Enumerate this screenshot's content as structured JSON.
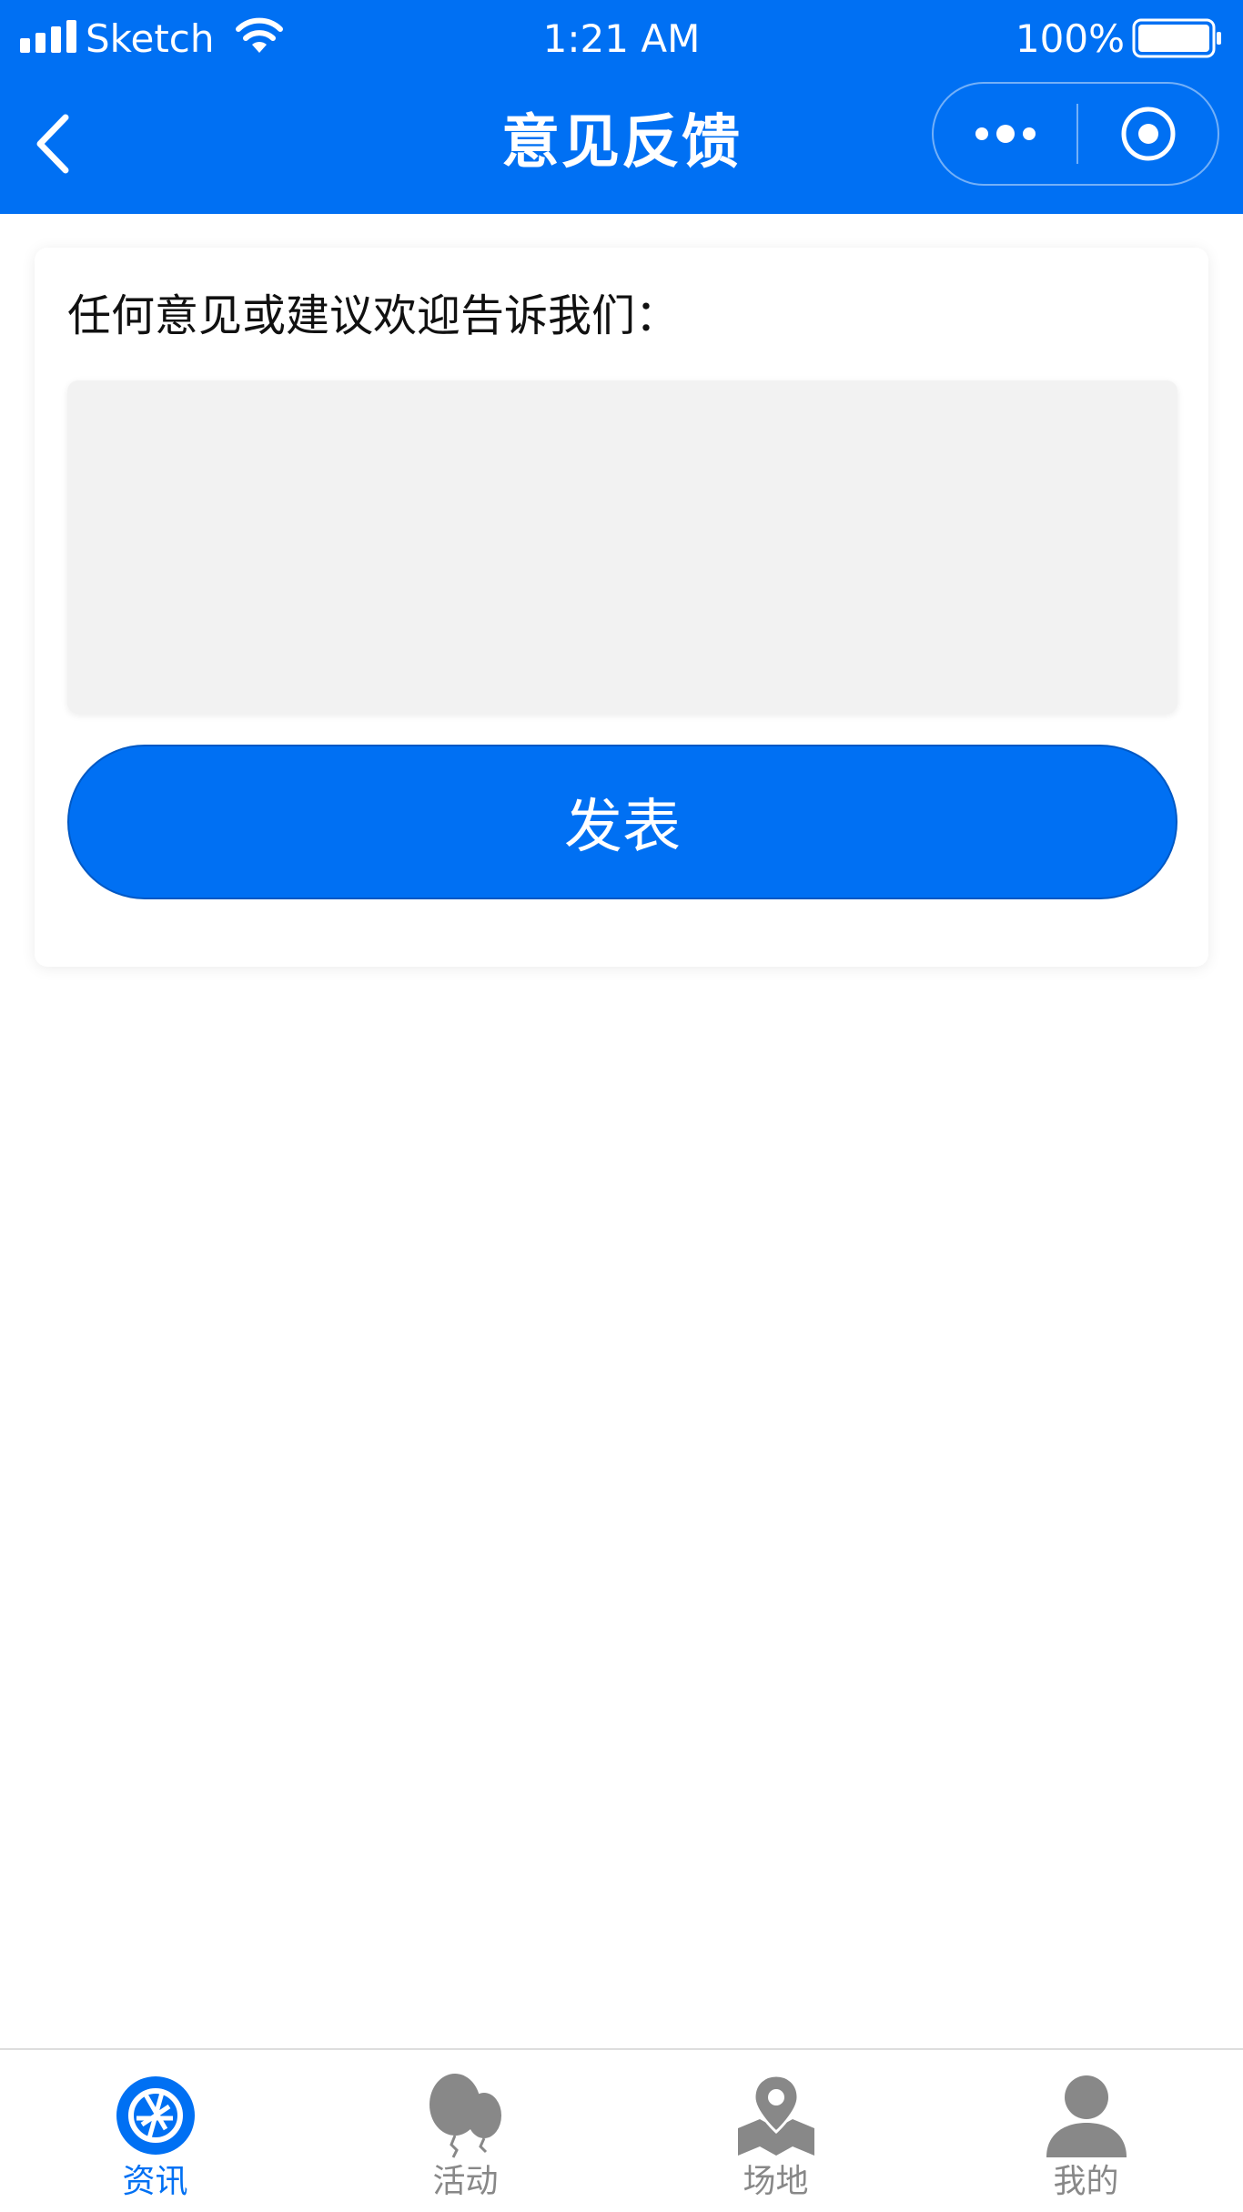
{
  "status_bar": {
    "carrier": "Sketch",
    "time": "1:21 AM",
    "battery_percent": "100%"
  },
  "nav": {
    "title": "意见反馈",
    "back_icon": "chevron-left-icon",
    "more_icon": "more-dots-icon",
    "close_icon": "target-circle-icon"
  },
  "feedback": {
    "prompt": "任何意见或建议欢迎告诉我们：",
    "textarea_value": "",
    "submit_label": "发表"
  },
  "tabs": [
    {
      "label": "资讯",
      "icon": "aperture-icon",
      "active": true
    },
    {
      "label": "活动",
      "icon": "balloon-icon",
      "active": false
    },
    {
      "label": "场地",
      "icon": "map-pin-icon",
      "active": false
    },
    {
      "label": "我的",
      "icon": "user-icon",
      "active": false
    }
  ],
  "colors": {
    "primary": "#0070f3",
    "tab_inactive": "#888888",
    "textarea_bg": "#f2f2f2"
  }
}
